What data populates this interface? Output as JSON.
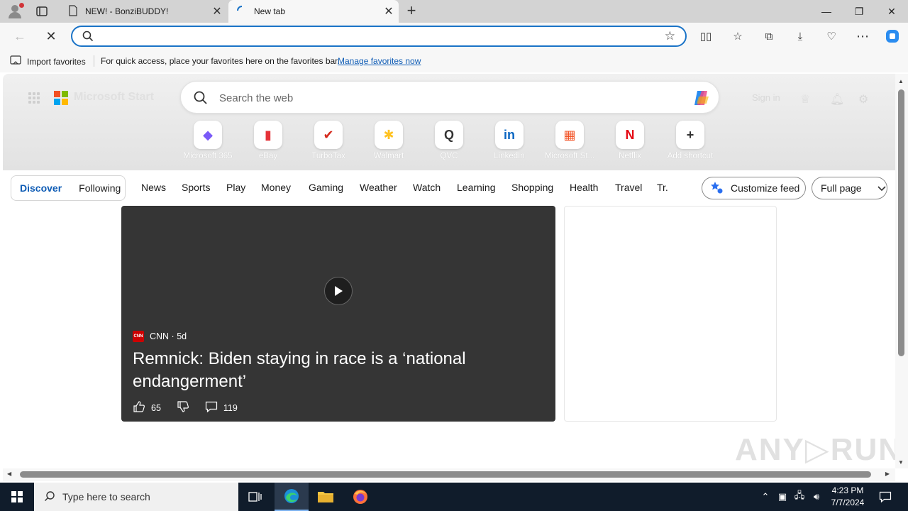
{
  "browser": {
    "tabs": [
      {
        "title": "NEW! - BonziBUDDY!",
        "active": false
      },
      {
        "title": "New tab",
        "active": true
      }
    ],
    "address": {
      "value": "",
      "placeholder": ""
    },
    "favorites_bar": {
      "import_label": "Import favorites",
      "message": "For quick access, place your favorites here on the favorites bar.",
      "manage_link": "Manage favorites now"
    }
  },
  "page": {
    "brand": "Microsoft Start",
    "search_placeholder": "Search the web",
    "signin": "Sign in",
    "shortcuts": [
      {
        "label": "Microsoft 365",
        "icon": "microsoft-365-icon",
        "glyph": "◆",
        "color": "#7a5af8"
      },
      {
        "label": "eBay",
        "icon": "ebay-icon",
        "glyph": "▮",
        "color": "#e53238"
      },
      {
        "label": "TurboTax",
        "icon": "turbotax-icon",
        "glyph": "✔",
        "color": "#d52b1e"
      },
      {
        "label": "Walmart",
        "icon": "walmart-icon",
        "glyph": "✱",
        "color": "#ffc220"
      },
      {
        "label": "QVC",
        "icon": "qvc-icon",
        "glyph": "Q",
        "color": "#333333"
      },
      {
        "label": "LinkedIn",
        "icon": "linkedin-icon",
        "glyph": "in",
        "color": "#0a66c2"
      },
      {
        "label": "Microsoft St...",
        "icon": "microsoft-store-icon",
        "glyph": "▦",
        "color": "#f25022"
      },
      {
        "label": "Netflix",
        "icon": "netflix-icon",
        "glyph": "N",
        "color": "#e50914"
      },
      {
        "label": "Add shortcut",
        "icon": "plus-icon",
        "glyph": "+",
        "color": "#333333"
      }
    ],
    "feed_tabs": {
      "discover": "Discover",
      "following": "Following"
    },
    "categories": [
      "News",
      "Sports",
      "Play",
      "Money",
      "Gaming",
      "Weather",
      "Watch",
      "Learning",
      "Shopping",
      "Health",
      "Travel",
      "Tr."
    ],
    "customize_feed": "Customize feed",
    "layout_select": "Full page",
    "video_card": {
      "source": "CNN",
      "age": "5d",
      "source_line": "CNN · 5d",
      "headline": "Remnick: Biden staying in race is a ‘national endangerment’",
      "likes": "65",
      "comments": "119"
    },
    "watermark": "ANY▷RUN"
  },
  "taskbar": {
    "search_placeholder": "Type here to search",
    "time": "4:23 PM",
    "date": "7/7/2024"
  },
  "colors": {
    "accent": "#1a73c7",
    "link": "#0f5cb5",
    "taskbar": "#101c2b",
    "card_bg": "#353535"
  }
}
